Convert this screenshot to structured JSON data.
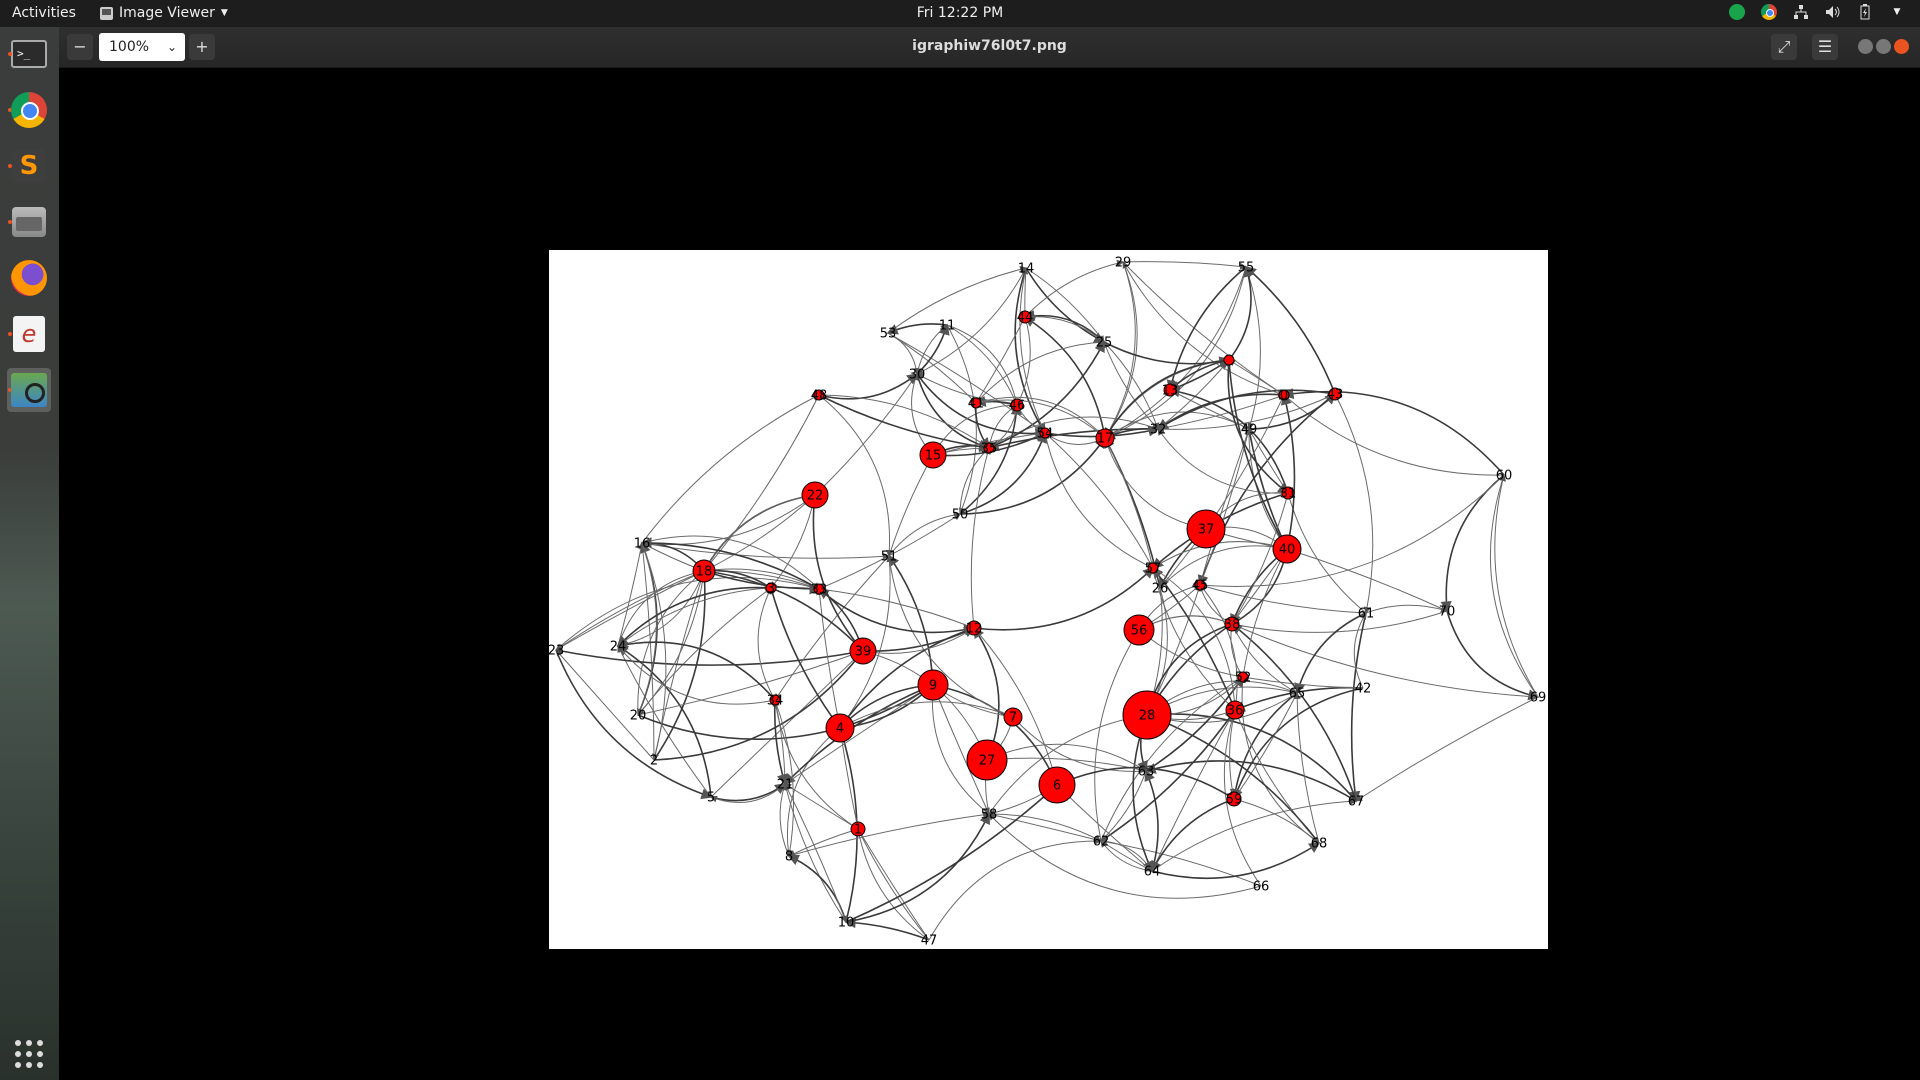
{
  "topbar": {
    "activities": "Activities",
    "app_menu": "Image Viewer",
    "clock": "Fri 12:22 PM"
  },
  "window": {
    "zoom": "100%",
    "title": "igraphiw76l0t7.png"
  },
  "graph": {
    "vertices": [
      {
        "label": "29",
        "size": 0
      },
      {
        "label": "55",
        "size": 0
      },
      {
        "label": "60",
        "size": 0
      },
      {
        "label": "70",
        "size": 0
      },
      {
        "label": "69",
        "size": 0
      },
      {
        "label": "61",
        "size": 0
      },
      {
        "label": "42",
        "size": 0
      },
      {
        "label": "65",
        "size": 0
      },
      {
        "label": "67",
        "size": 0
      },
      {
        "label": "68",
        "size": 0
      },
      {
        "label": "66",
        "size": 0
      },
      {
        "label": "64",
        "size": 0
      },
      {
        "label": "62",
        "size": 0
      },
      {
        "label": "58",
        "size": 0
      },
      {
        "label": "47",
        "size": 0
      },
      {
        "label": "10",
        "size": 0
      },
      {
        "label": "8",
        "size": 0
      },
      {
        "label": "5",
        "size": 0
      },
      {
        "label": "2",
        "size": 0
      },
      {
        "label": "20",
        "size": 0
      },
      {
        "label": "23",
        "size": 0
      },
      {
        "label": "24",
        "size": 0
      },
      {
        "label": "16",
        "size": 0
      },
      {
        "label": "51",
        "size": 0
      },
      {
        "label": "53",
        "size": 0
      },
      {
        "label": "11",
        "size": 0
      },
      {
        "label": "14",
        "size": 0
      },
      {
        "label": "30",
        "size": 0
      },
      {
        "label": "25",
        "size": 0
      },
      {
        "label": "32",
        "size": 0
      },
      {
        "label": "49",
        "size": 0
      },
      {
        "label": "50",
        "size": 0
      },
      {
        "label": "19",
        "size": 0
      },
      {
        "label": "26",
        "size": 0
      },
      {
        "label": "21",
        "size": 0
      },
      {
        "label": "63",
        "size": 0
      },
      {
        "label": "28",
        "size": 24
      },
      {
        "label": "27",
        "size": 20
      },
      {
        "label": "37",
        "size": 19
      },
      {
        "label": "6",
        "size": 18
      },
      {
        "label": "56",
        "size": 15
      },
      {
        "label": "9",
        "size": 15
      },
      {
        "label": "4",
        "size": 14
      },
      {
        "label": "40",
        "size": 14
      },
      {
        "label": "15",
        "size": 13
      },
      {
        "label": "39",
        "size": 13
      },
      {
        "label": "22",
        "size": 13
      },
      {
        "label": "18",
        "size": 11
      },
      {
        "label": "36",
        "size": 9
      },
      {
        "label": "17",
        "size": 9
      },
      {
        "label": "7",
        "size": 9
      },
      {
        "label": "1",
        "size": 7
      },
      {
        "label": "38",
        "size": 7
      },
      {
        "label": "12",
        "size": 7
      },
      {
        "label": "59",
        "size": 7
      },
      {
        "label": "43",
        "size": 6
      },
      {
        "label": "31",
        "size": 6
      },
      {
        "label": "44",
        "size": 6
      },
      {
        "label": "46",
        "size": 6
      },
      {
        "label": "13",
        "size": 6
      },
      {
        "label": "48",
        "size": 5
      },
      {
        "label": "3",
        "size": 5
      },
      {
        "label": "33",
        "size": 5
      },
      {
        "label": "34",
        "size": 5
      },
      {
        "label": "35",
        "size": 5
      },
      {
        "label": "41",
        "size": 5
      },
      {
        "label": "45",
        "size": 5
      },
      {
        "label": "52",
        "size": 5
      },
      {
        "label": "54",
        "size": 5
      },
      {
        "label": "57",
        "size": 5
      },
      {
        "label": "0",
        "size": 5
      },
      {
        "label": "",
        "size": 5
      }
    ]
  }
}
